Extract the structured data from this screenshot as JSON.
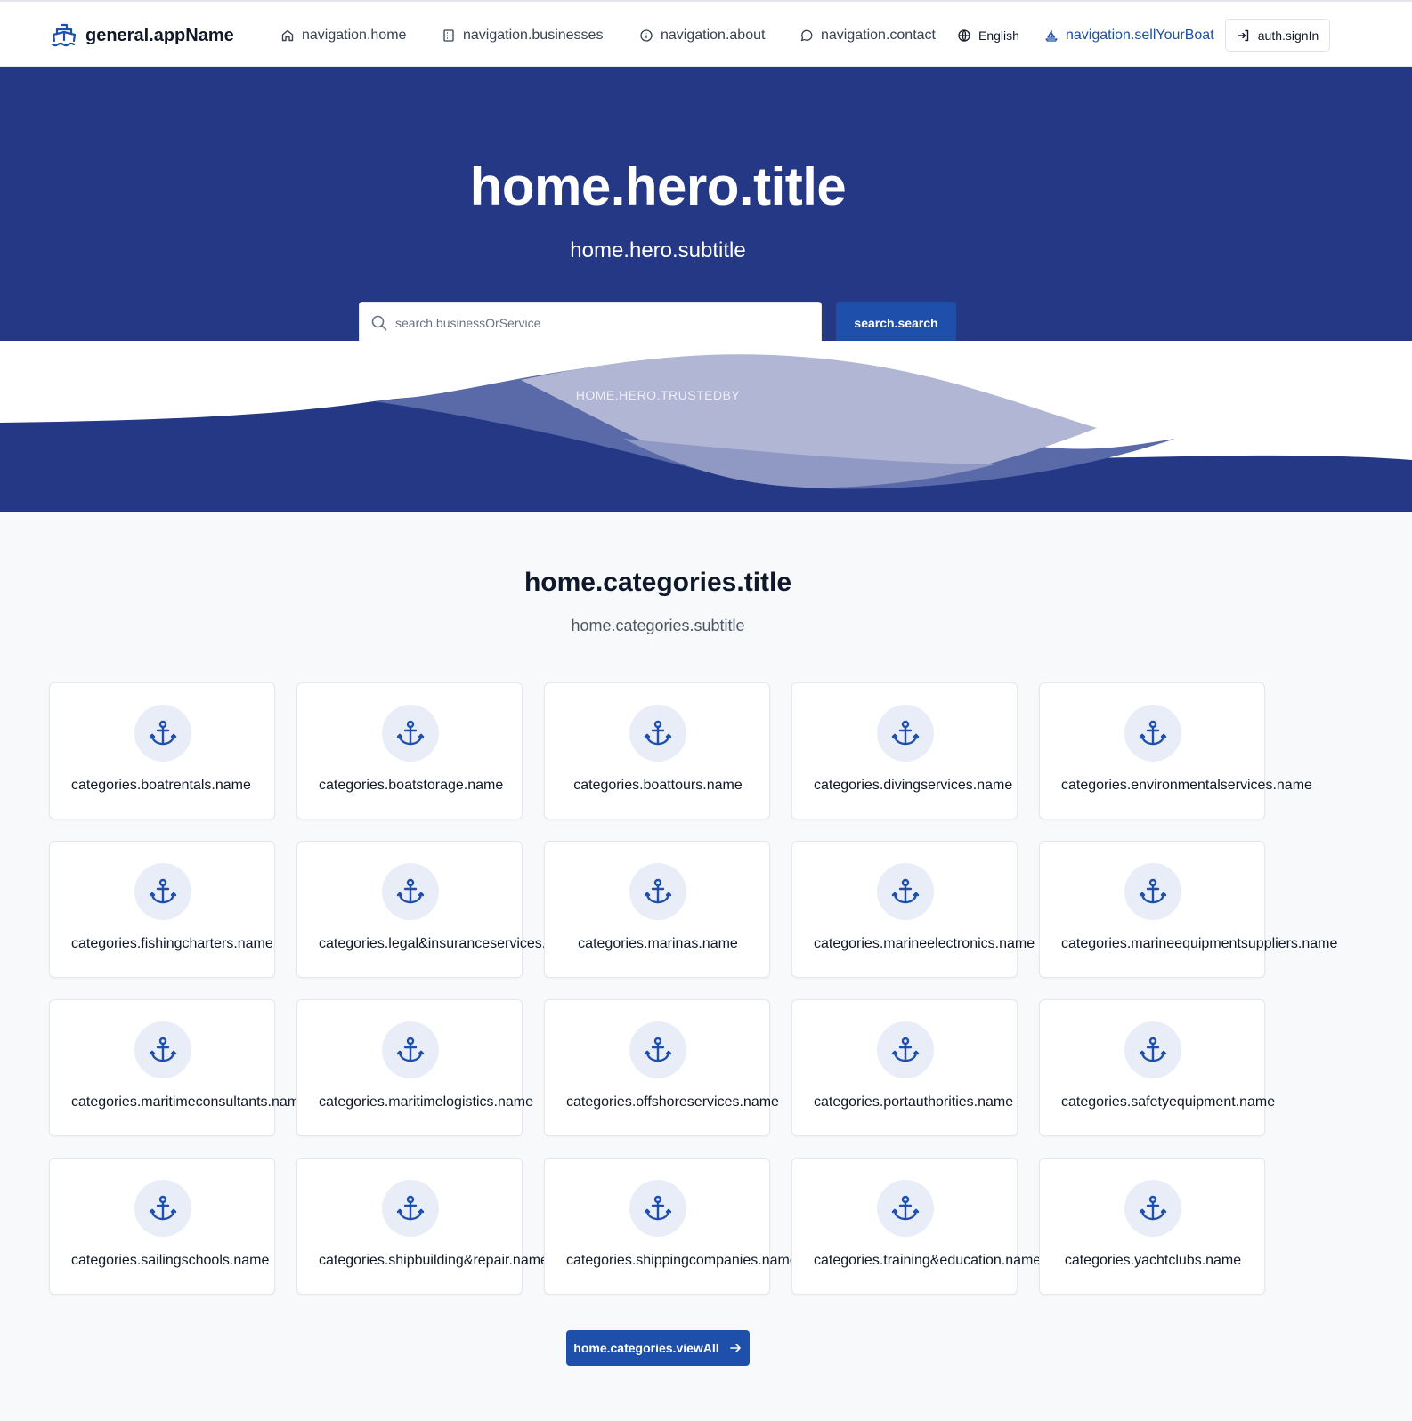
{
  "header": {
    "app_name": "general.appName",
    "nav": {
      "home": "navigation.home",
      "businesses": "navigation.businesses",
      "about": "navigation.about",
      "contact": "navigation.contact",
      "language": "English",
      "sell": "navigation.sellYourBoat",
      "signin": "auth.signIn"
    }
  },
  "hero": {
    "title": "home.hero.title",
    "subtitle": "home.hero.subtitle",
    "search_placeholder": "search.businessOrService",
    "search_button": "search.search",
    "trusted_by": "HOME.HERO.TRUSTEDBY"
  },
  "categories": {
    "title": "home.categories.title",
    "subtitle": "home.categories.subtitle",
    "items": [
      "categories.boatrentals.name",
      "categories.boatstorage.name",
      "categories.boattours.name",
      "categories.divingservices.name",
      "categories.environmentalservices.name",
      "categories.fishingcharters.name",
      "categories.legal&insuranceservices.name",
      "categories.marinas.name",
      "categories.marineelectronics.name",
      "categories.marineequipmentsuppliers.name",
      "categories.maritimeconsultants.name",
      "categories.maritimelogistics.name",
      "categories.offshoreservices.name",
      "categories.portauthorities.name",
      "categories.safetyequipment.name",
      "categories.sailingschools.name",
      "categories.shipbuilding&repair.name",
      "categories.shippingcompanies.name",
      "categories.training&education.name",
      "categories.yachtclubs.name"
    ],
    "view_all": "home.categories.viewAll",
    "icon": "anchor-icon"
  },
  "colors": {
    "primary": "#1e4faa",
    "hero_bg": "#253885",
    "page_bg": "#f8f9fb"
  }
}
